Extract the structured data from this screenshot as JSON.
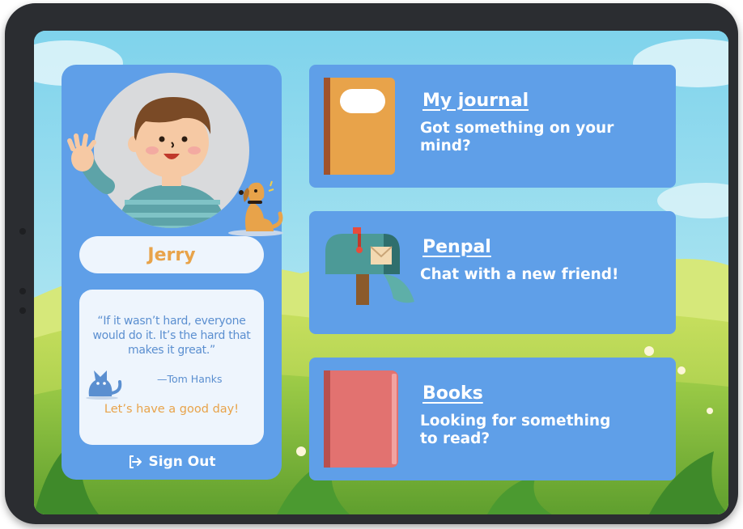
{
  "profile": {
    "name": "Jerry",
    "quote": "“If it wasn’t hard, everyone would do it. It’s the hard that makes it great.”",
    "quote_author": "—Tom Hanks",
    "greeting": "Let’s have a good day!",
    "sign_out_label": "Sign Out"
  },
  "cards": [
    {
      "title": "My journal",
      "subtitle": "Got something on your mind?",
      "icon": "journal-icon"
    },
    {
      "title": "Penpal",
      "subtitle": "Chat with a new friend!",
      "icon": "mailbox-icon"
    },
    {
      "title": "Books",
      "subtitle": "Looking for something to read?",
      "icon": "book-icon"
    }
  ],
  "colors": {
    "panel": "#5f9fe8",
    "accent_orange": "#e8a34a",
    "quote_blue": "#5b8fd0",
    "card_bg_light": "#eef5fd"
  }
}
